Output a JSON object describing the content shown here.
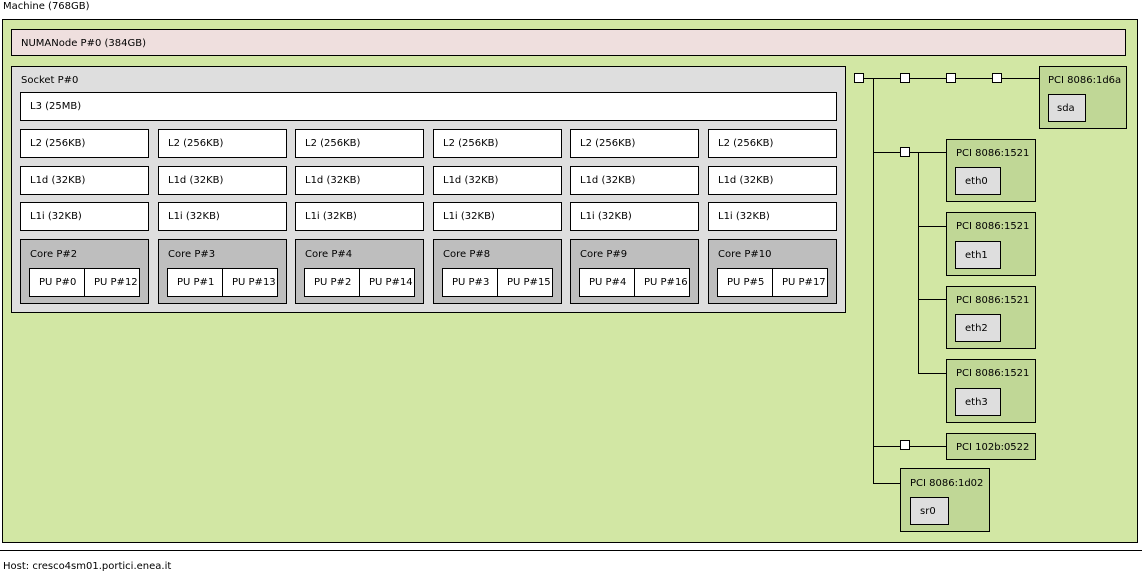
{
  "machine": {
    "label": "Machine (768GB)"
  },
  "numa": {
    "label": "NUMANode P#0 (384GB)"
  },
  "socket": {
    "label": "Socket P#0",
    "l3": "L3 (25MB)",
    "l2": [
      "L2 (256KB)",
      "L2 (256KB)",
      "L2 (256KB)",
      "L2 (256KB)",
      "L2 (256KB)",
      "L2 (256KB)"
    ],
    "l1d": [
      "L1d (32KB)",
      "L1d (32KB)",
      "L1d (32KB)",
      "L1d (32KB)",
      "L1d (32KB)",
      "L1d (32KB)"
    ],
    "l1i": [
      "L1i (32KB)",
      "L1i (32KB)",
      "L1i (32KB)",
      "L1i (32KB)",
      "L1i (32KB)",
      "L1i (32KB)"
    ],
    "cores": [
      {
        "label": "Core P#2",
        "pus": [
          "PU P#0",
          "PU P#12"
        ]
      },
      {
        "label": "Core P#3",
        "pus": [
          "PU P#1",
          "PU P#13"
        ]
      },
      {
        "label": "Core P#4",
        "pus": [
          "PU P#2",
          "PU P#14"
        ]
      },
      {
        "label": "Core P#8",
        "pus": [
          "PU P#3",
          "PU P#15"
        ]
      },
      {
        "label": "Core P#9",
        "pus": [
          "PU P#4",
          "PU P#16"
        ]
      },
      {
        "label": "Core P#10",
        "pus": [
          "PU P#5",
          "PU P#17"
        ]
      }
    ]
  },
  "pci": [
    {
      "label": "PCI 8086:1d6a",
      "device": "sda"
    },
    {
      "label": "PCI 8086:1521",
      "device": "eth0"
    },
    {
      "label": "PCI 8086:1521",
      "device": "eth1"
    },
    {
      "label": "PCI 8086:1521",
      "device": "eth2"
    },
    {
      "label": "PCI 8086:1521",
      "device": "eth3"
    },
    {
      "label": "PCI 102b:0522",
      "device": ""
    },
    {
      "label": "PCI 8086:1d02",
      "device": "sr0"
    }
  ],
  "footer": {
    "host": "Host: cresco4sm01.portici.enea.it"
  },
  "colors": {
    "machine": "#d2e7a4",
    "numa": "#efdfde",
    "socket": "#dedede",
    "core": "#bebebe",
    "pci": "#c0d796",
    "osdev": "#dedede"
  }
}
